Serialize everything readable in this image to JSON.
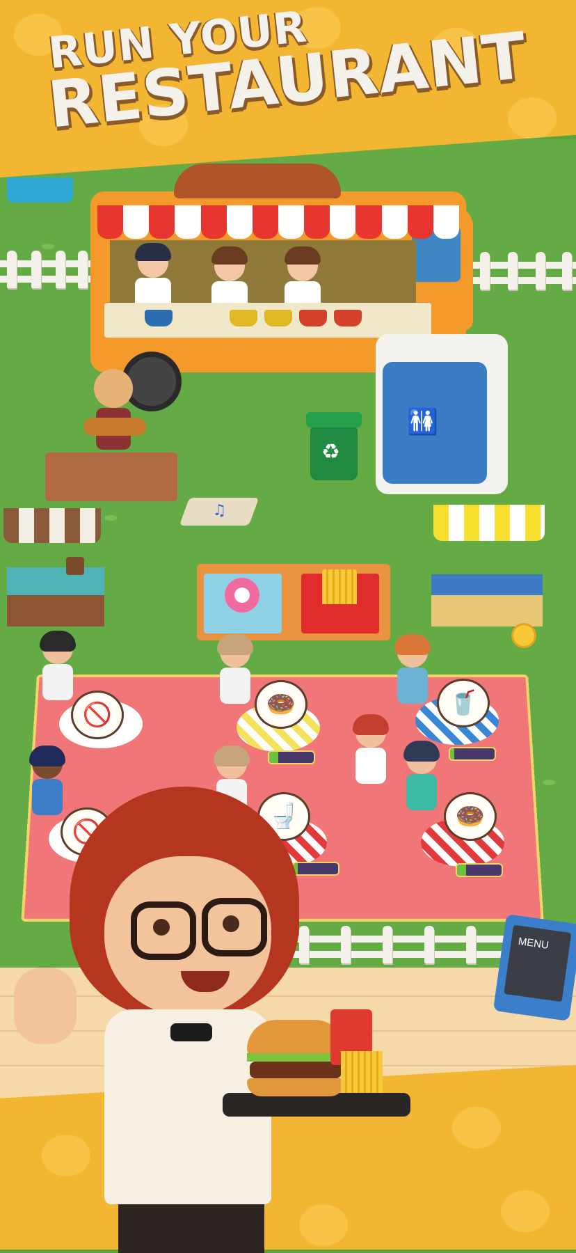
{
  "banner": {
    "line1": "RUN YOUR",
    "line2": "RESTAURANT"
  },
  "menu_board": {
    "label": "MENU"
  },
  "colors": {
    "banner": "#f2b632",
    "title_text": "#f4f0ea",
    "title_shadow": "#8a5a2a",
    "grass": "#64ab45",
    "carpet": "#f07677"
  },
  "scene": {
    "food_truck": {
      "icon": "burger-icon"
    },
    "restroom": {
      "icon": "restroom-icon"
    },
    "recycle_bin": {
      "icon": "recycle-icon"
    },
    "food_stand": {
      "items": [
        "donut-icon",
        "fries-icon"
      ]
    },
    "customers": [
      {
        "order": "pot-blocked-icon",
        "patience": 0.0
      },
      {
        "order": "donut-icon",
        "patience": 0.2
      },
      {
        "order": "lemonade-icon",
        "patience": 0.1
      },
      {
        "order": "pot-blocked-icon",
        "patience": 0.0
      },
      {
        "order": "toilet-icon",
        "patience": 0.1
      },
      {
        "order": "donut-icon",
        "patience": 0.2
      }
    ]
  }
}
